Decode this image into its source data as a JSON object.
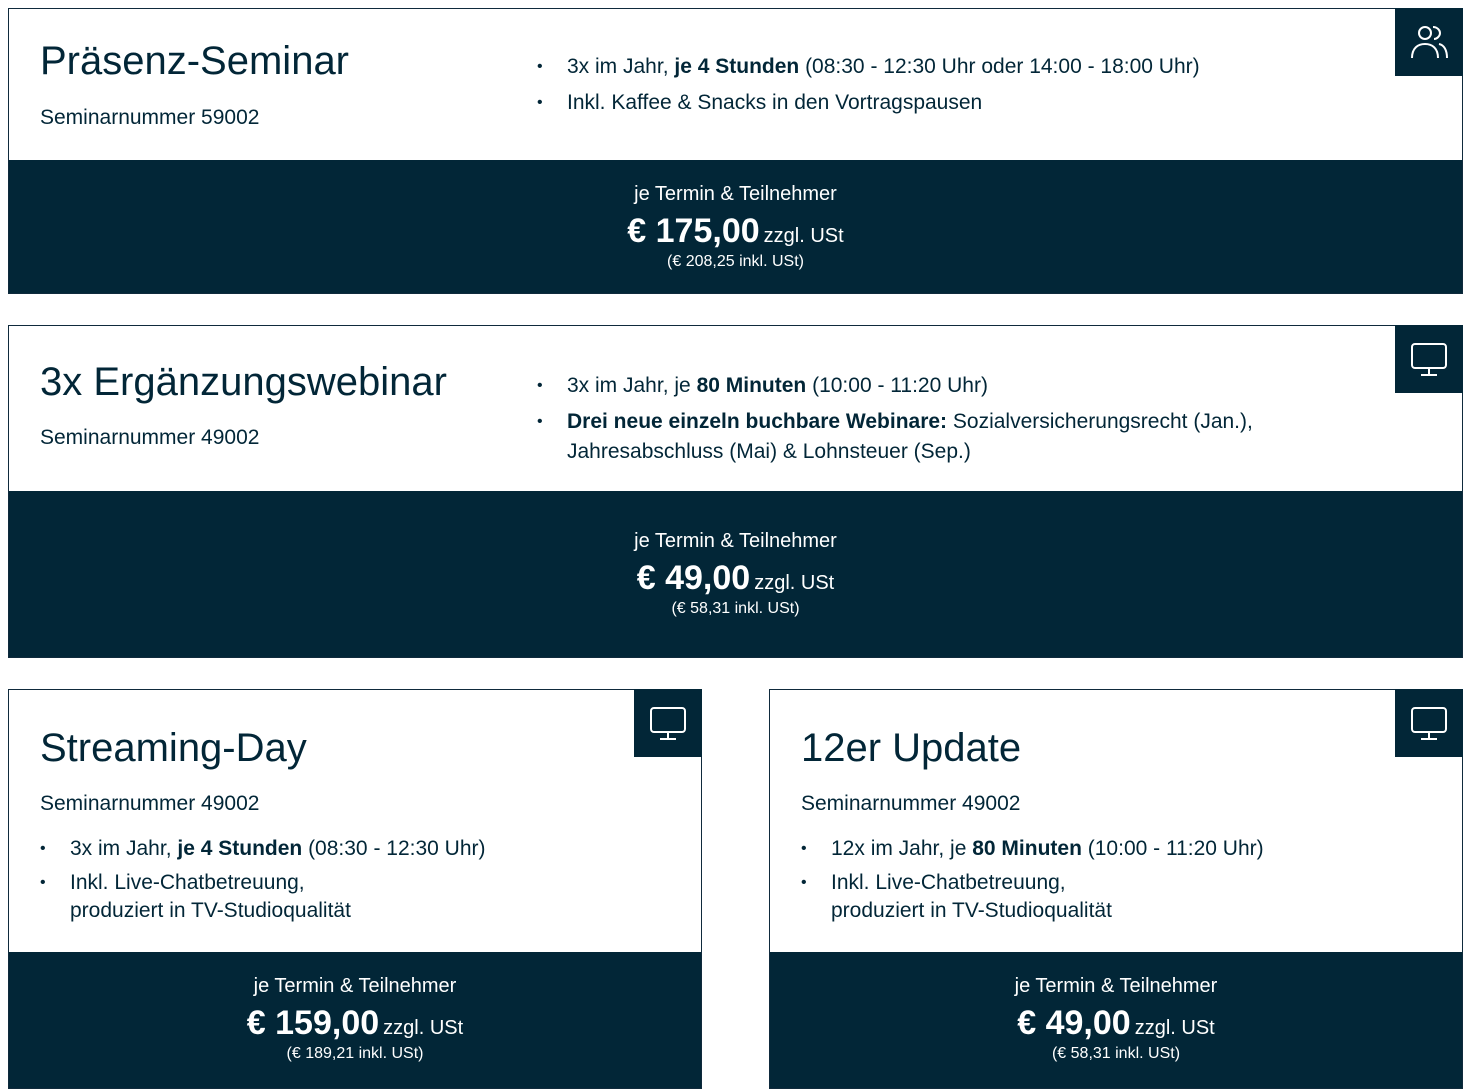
{
  "cards": [
    {
      "title": "Präsenz-Seminar",
      "seminar_number": "Seminarnummer 59002",
      "icon": "people-icon",
      "features": [
        {
          "pre": "3x im Jahr, ",
          "bold": "je 4 Stunden",
          "post": " (08:30 - 12:30 Uhr oder 14:00 - 18:00 Uhr)"
        },
        {
          "pre": "Inkl. Kaffee & Snacks in den Vortragspausen",
          "bold": "",
          "post": ""
        }
      ],
      "price_label": "je Termin & Teilnehmer",
      "price": "€ 175,00",
      "tax_note": "zzgl. USt",
      "gross": "(€ 208,25 inkl. USt)"
    },
    {
      "title": "3x Ergänzungswebinar",
      "seminar_number": "Seminarnummer 49002",
      "icon": "monitor-icon",
      "features": [
        {
          "pre": "3x im Jahr, je ",
          "bold": "80 Minuten",
          "post": " (10:00 - 11:20 Uhr)"
        },
        {
          "pre": "",
          "bold": "Drei neue einzeln buchbare Webinare:",
          "post": " Sozialversicherungsrecht (Jan.), Jahresabschluss (Mai) & Lohnsteuer (Sep.)"
        }
      ],
      "price_label": "je Termin & Teilnehmer",
      "price": "€ 49,00",
      "tax_note": "zzgl. USt",
      "gross": "(€ 58,31 inkl. USt)"
    },
    {
      "title": "Streaming-Day",
      "seminar_number": "Seminarnummer 49002",
      "icon": "monitor-icon",
      "features": [
        {
          "pre": "3x im Jahr, ",
          "bold": "je 4 Stunden",
          "post": " (08:30 - 12:30 Uhr)"
        },
        {
          "pre": "Inkl. Live-Chatbetreuung,",
          "bold": "",
          "post": "produziert in TV-Studioqualität"
        }
      ],
      "price_label": "je Termin & Teilnehmer",
      "price": "€ 159,00",
      "tax_note": "zzgl. USt",
      "gross": "(€ 189,21 inkl. USt)"
    },
    {
      "title": "12er Update",
      "seminar_number": "Seminarnummer 49002",
      "icon": "monitor-icon",
      "features": [
        {
          "pre": "12x im Jahr, je ",
          "bold": "80 Minuten",
          "post": " (10:00 - 11:20 Uhr)"
        },
        {
          "pre": "Inkl. Live-Chatbetreuung,",
          "bold": "",
          "post": "produziert in TV-Studioqualität"
        }
      ],
      "price_label": "je Termin & Teilnehmer",
      "price": "€ 49,00",
      "tax_note": "zzgl. USt",
      "gross": "(€ 58,31 inkl. USt)"
    }
  ],
  "bullet_char": "•",
  "colors": {
    "navy": "#022637",
    "border": "#0f2a3c",
    "text_on_dark": "#ffffff"
  }
}
